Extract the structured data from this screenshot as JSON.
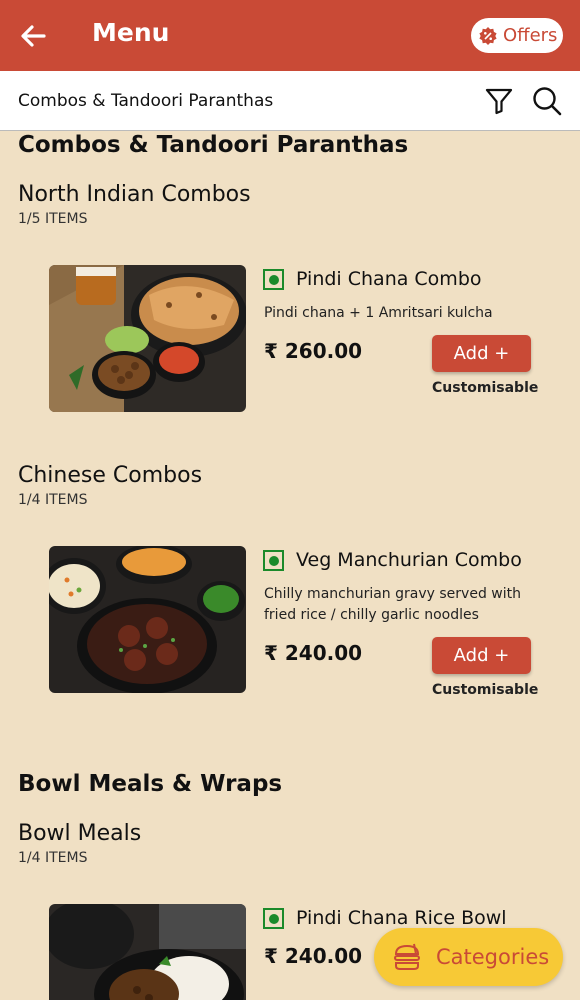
{
  "header": {
    "title": "Menu",
    "offers_label": "Offers"
  },
  "subheader": {
    "title": "Combos & Tandoori Paranthas"
  },
  "sections": [
    {
      "title": "Combos & Tandoori Paranthas",
      "categories": [
        {
          "title": "North Indian Combos",
          "count": "1/5 ITEMS",
          "items": [
            {
              "name": "Pindi Chana Combo",
              "description": "Pindi chana + 1 Amritsari kulcha",
              "price": "₹ 260.00",
              "add_label": "Add +",
              "note": "Customisable"
            }
          ]
        },
        {
          "title": "Chinese Combos",
          "count": "1/4 ITEMS",
          "items": [
            {
              "name": "Veg Manchurian Combo",
              "description": "Chilly manchurian gravy served with fried rice / chilly garlic noodles",
              "price": "₹ 240.00",
              "add_label": "Add +",
              "note": "Customisable"
            }
          ]
        }
      ]
    },
    {
      "title": "Bowl Meals & Wraps",
      "categories": [
        {
          "title": "Bowl Meals",
          "count": "1/4 ITEMS",
          "items": [
            {
              "name": "Pindi Chana Rice Bowl",
              "price": "₹ 240.00"
            }
          ]
        }
      ]
    }
  ],
  "fab": {
    "categories_label": "Categories"
  },
  "colors": {
    "brand": "#c94a36",
    "background": "#f0e0c4",
    "veg": "#1b8a2a",
    "fab": "#f7c936"
  },
  "icons": [
    "back-arrow-icon",
    "offers-badge-icon",
    "filter-icon",
    "search-icon",
    "veg-indicator-icon",
    "burger-icon"
  ]
}
